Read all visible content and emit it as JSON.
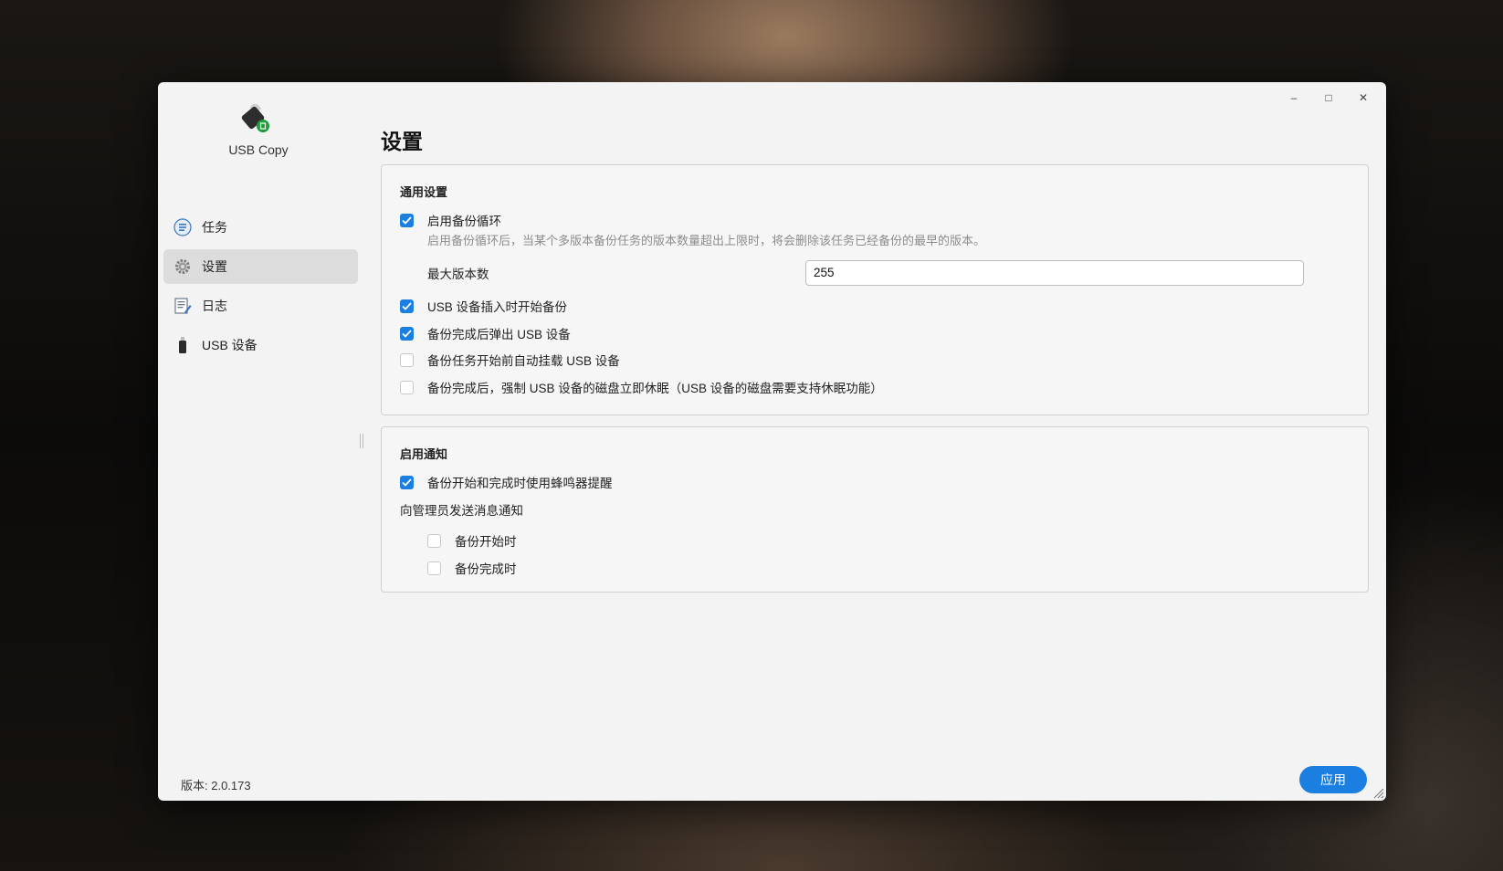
{
  "window": {
    "minimize": "–",
    "maximize": "□",
    "close": "✕"
  },
  "app": {
    "name": "USB Copy",
    "version": "版本: 2.0.173"
  },
  "sidebar": {
    "items": [
      {
        "label": "任务",
        "icon": "task-list-icon"
      },
      {
        "label": "设置",
        "icon": "gear-icon",
        "active": true
      },
      {
        "label": "日志",
        "icon": "log-icon"
      },
      {
        "label": "USB 设备",
        "icon": "usb-drive-icon"
      }
    ]
  },
  "page": {
    "title": "设置"
  },
  "general": {
    "title": "通用设置",
    "backup_cycle": {
      "label": "启用备份循环",
      "checked": true
    },
    "backup_cycle_hint": "启用备份循环后，当某个多版本备份任务的版本数量超出上限时，将会删除该任务已经备份的最早的版本。",
    "max_versions_label": "最大版本数",
    "max_versions_value": "255",
    "options": [
      {
        "label": "USB 设备插入时开始备份",
        "checked": true
      },
      {
        "label": "备份完成后弹出 USB 设备",
        "checked": true
      },
      {
        "label": "备份任务开始前自动挂载 USB 设备",
        "checked": false
      },
      {
        "label": "备份完成后，强制 USB 设备的磁盘立即休眠（USB 设备的磁盘需要支持休眠功能）",
        "checked": false
      }
    ]
  },
  "notify": {
    "title": "启用通知",
    "buzzer": {
      "label": "备份开始和完成时使用蜂鸣器提醒",
      "checked": true
    },
    "admin_label": "向管理员发送消息通知",
    "admin_options": [
      {
        "label": "备份开始时",
        "checked": false
      },
      {
        "label": "备份完成时",
        "checked": false
      }
    ]
  },
  "footer": {
    "apply_label": "应用"
  },
  "colors": {
    "accent": "#1a7fe0",
    "background": "#f3f3f3"
  }
}
